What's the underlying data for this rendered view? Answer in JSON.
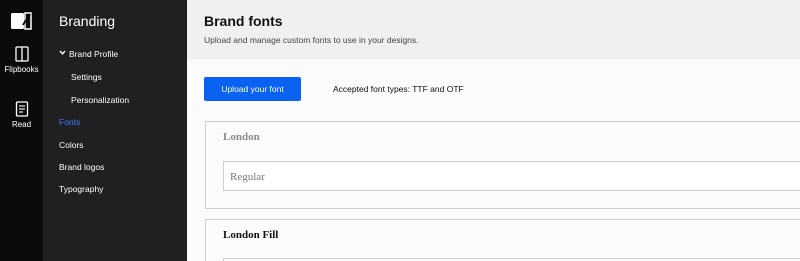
{
  "rail": {
    "logo_icon": "book-logo-icon",
    "items": [
      {
        "label": "Flipbooks",
        "icon": "flipbooks-icon"
      },
      {
        "label": "Read",
        "icon": "read-icon"
      }
    ]
  },
  "sidebar": {
    "heading": "Branding",
    "brand_profile": "Brand Profile",
    "items": [
      {
        "label": "Settings"
      },
      {
        "label": "Personalization"
      },
      {
        "label": "Fonts"
      },
      {
        "label": "Colors"
      },
      {
        "label": "Brand logos"
      },
      {
        "label": "Typography"
      }
    ],
    "active_item": "Fonts"
  },
  "header": {
    "title": "Brand fonts",
    "subtitle": "Upload and manage custom fonts to use in your designs."
  },
  "main": {
    "upload_label": "Upload your font",
    "accepted_types": "Accepted font types: TTF and OTF",
    "fonts": [
      {
        "name": "London",
        "variants": [
          "Regular"
        ]
      },
      {
        "name": "London Fill",
        "variants": []
      }
    ]
  },
  "colors": {
    "rail_bg": "#0b0b0b",
    "sidebar_bg": "#202022",
    "active_link": "#3b7bff",
    "primary_button": "#0a62f2",
    "header_bg": "#f0f0f2"
  }
}
